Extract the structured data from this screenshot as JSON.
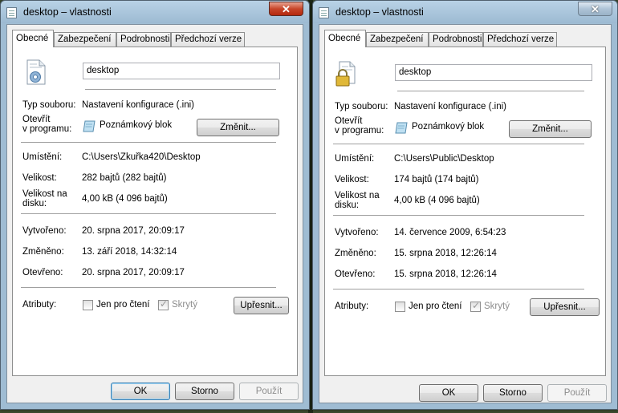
{
  "windows": [
    {
      "title": "desktop – vlastnosti",
      "tabs": [
        "Obecné",
        "Zabezpečení",
        "Podrobnosti",
        "Předchozí verze"
      ],
      "file_name": "desktop",
      "icon": "config-file-gear-icon",
      "close_glyph": "✕",
      "type_label": "Typ souboru:",
      "type_value": "Nastavení konfigurace (.ini)",
      "opens_with_label_1": "Otevřít",
      "opens_with_label_2": "v programu:",
      "opens_with_value": "Poznámkový blok",
      "change_button": "Změnit...",
      "location_label": "Umístění:",
      "location_value": "C:\\Users\\Zkuřka420\\Desktop",
      "size_label": "Velikost:",
      "size_value": "282 bajtů (282 bajtů)",
      "size_disk_label_1": "Velikost na",
      "size_disk_label_2": "disku:",
      "size_disk_value": "4,00 kB (4 096 bajtů)",
      "created_label": "Vytvořeno:",
      "created_value": "20. srpna 2017, 20:09:17",
      "modified_label": "Změněno:",
      "modified_value": "13. září 2018, 14:32:14",
      "accessed_label": "Otevřeno:",
      "accessed_value": "20. srpna 2017, 20:09:17",
      "attributes_label": "Atributy:",
      "readonly_label": "Jen pro čtení",
      "hidden_label": "Skrytý",
      "advanced_button": "Upřesnit...",
      "ok_button": "OK",
      "cancel_button": "Storno",
      "apply_button": "Použít"
    },
    {
      "title": "desktop – vlastnosti",
      "tabs": [
        "Obecné",
        "Zabezpečení",
        "Podrobnosti",
        "Předchozí verze"
      ],
      "file_name": "desktop",
      "icon": "locked-file-icon",
      "close_glyph": "✕",
      "type_label": "Typ souboru:",
      "type_value": "Nastavení konfigurace (.ini)",
      "opens_with_label_1": "Otevřít",
      "opens_with_label_2": "v programu:",
      "opens_with_value": "Poznámkový blok",
      "change_button": "Změnit...",
      "location_label": "Umístění:",
      "location_value": "C:\\Users\\Public\\Desktop",
      "size_label": "Velikost:",
      "size_value": "174 bajtů (174 bajtů)",
      "size_disk_label_1": "Velikost na",
      "size_disk_label_2": "disku:",
      "size_disk_value": "4,00 kB (4 096 bajtů)",
      "created_label": "Vytvořeno:",
      "created_value": "14. července 2009, 6:54:23",
      "modified_label": "Změněno:",
      "modified_value": "15. srpna 2018, 12:26:14",
      "accessed_label": "Otevřeno:",
      "accessed_value": "15. srpna 2018, 12:26:14",
      "attributes_label": "Atributy:",
      "readonly_label": "Jen pro čtení",
      "hidden_label": "Skrytý",
      "advanced_button": "Upřesnit...",
      "ok_button": "OK",
      "cancel_button": "Storno",
      "apply_button": "Použít"
    }
  ],
  "colors": {
    "accent": "#3c7fb1",
    "close_red": "#c7462a",
    "frame": "#9fbcd3"
  }
}
